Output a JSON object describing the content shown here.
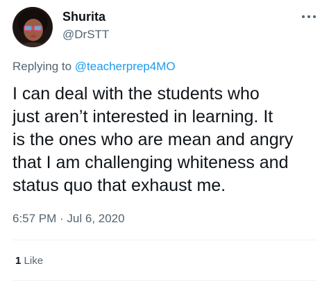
{
  "author": {
    "display_name": "Shurita",
    "handle": "@DrSTT"
  },
  "reply": {
    "prefix": "Replying to ",
    "mention": "@teacherprep4MO"
  },
  "tweet": {
    "text": "I can deal with the students who\njust aren’t interested in learning.  It\nis the ones who are mean and angry\nthat I am challenging whiteness and\nstatus quo that exhaust me.",
    "timestamp": "6:57 PM · Jul 6, 2020"
  },
  "engagement": {
    "like_count": "1",
    "like_label": "Like"
  },
  "icons": {
    "more": "more-horizontal-icon",
    "avatar": "profile-photo"
  },
  "colors": {
    "text_primary": "#0f1419",
    "text_secondary": "#536471",
    "link": "#1d9bf0",
    "divider": "#eff3f4"
  }
}
